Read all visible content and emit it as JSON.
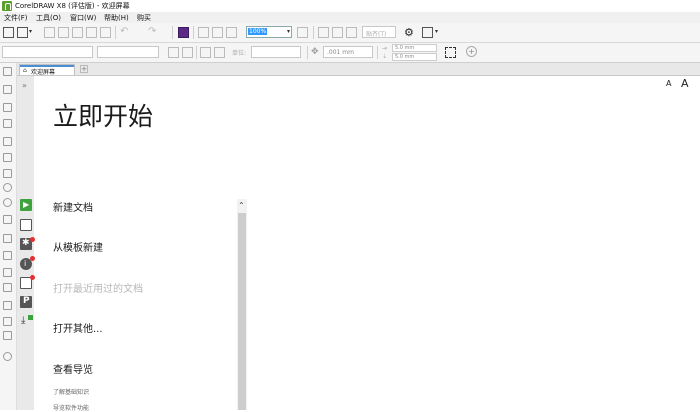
{
  "window": {
    "title": "CorelDRAW X8 (评估版) - 欢迎屏幕"
  },
  "menu": [
    {
      "label": "文件(F)"
    },
    {
      "label": "工具(O)"
    },
    {
      "label": "窗口(W)"
    },
    {
      "label": "帮助(H)"
    },
    {
      "label": "购买"
    }
  ],
  "toolbar": {
    "zoom_value": "100%",
    "snap_label": "贴齐(T)",
    "nudge_value": ".001 mm",
    "dup_x": "5.0 mm",
    "dup_y": "5.0 mm",
    "units_label": "单位:"
  },
  "tab": {
    "label": "欢迎屏幕"
  },
  "welcome": {
    "title": "立即开始",
    "font_small": "A",
    "font_large": "A",
    "items": [
      {
        "label": "新建文档",
        "enabled": true
      },
      {
        "label": "从模板新建",
        "enabled": true
      },
      {
        "label": "打开最近用过的文档",
        "enabled": false
      },
      {
        "label": "打开其他...",
        "enabled": true
      },
      {
        "label": "查看导览",
        "enabled": true
      }
    ],
    "sub_items": [
      "了解基础知识",
      "导览软件功能"
    ]
  },
  "colors": {
    "accent": "#3399ff",
    "logo": "#5aa02c",
    "badge": "#e53030",
    "play": "#3ea33e"
  }
}
